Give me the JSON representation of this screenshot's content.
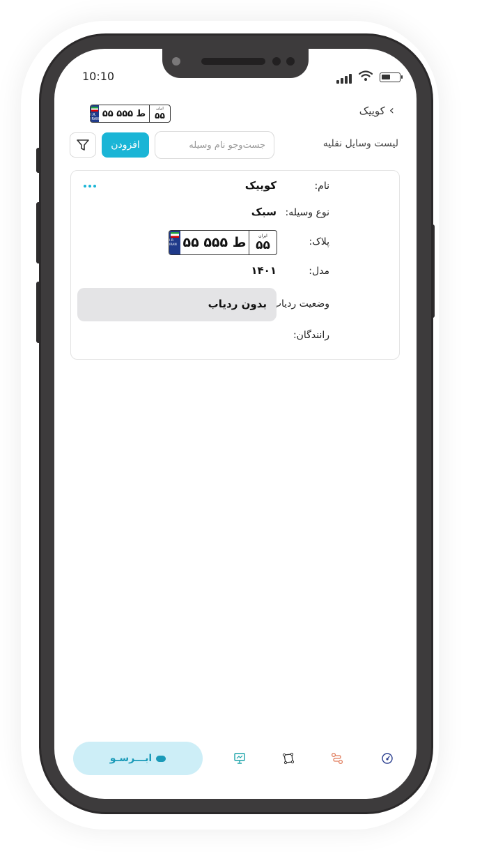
{
  "status_bar": {
    "time": "10:10"
  },
  "header": {
    "title": "کوییک",
    "plate": {
      "number": "۵۵ ط ۵۵۵",
      "region": "۵۵",
      "region_label": "ایران",
      "flag_text": "I.R. IRAN"
    }
  },
  "toolbar": {
    "list_title": "لیست وسایل نقلیه",
    "search_placeholder": "جست‌وجو نام وسیله",
    "add_label": "افزودن"
  },
  "vehicle_card": {
    "name_label": "نام:",
    "name_value": "کوییک",
    "type_label": "نوع وسیله:",
    "type_value": "سبک",
    "plate_label": "پلاک:",
    "plate": {
      "number": "۵۵ ط ۵۵۵",
      "region": "۵۵",
      "region_label": "ایران",
      "flag_text": "I.R. IRAN"
    },
    "model_label": "مدل:",
    "model_value": "۱۴۰۱",
    "tracker_label": "وضعیت ردیاب:",
    "tracker_value": "بدون ردیاب",
    "drivers_label": "رانندگان:"
  },
  "tabbar": {
    "brand_text": "ابـــرسـو",
    "tabs": [
      "presentation-icon",
      "polygon-icon",
      "route-icon",
      "gauge-icon"
    ]
  },
  "colors": {
    "accent": "#1ab5d6",
    "brand_pill": "#cdeef7",
    "tracker_bg": "#e4e4e6",
    "tab_route": "#e07b5a",
    "tab_gauge": "#2b3f8f"
  }
}
